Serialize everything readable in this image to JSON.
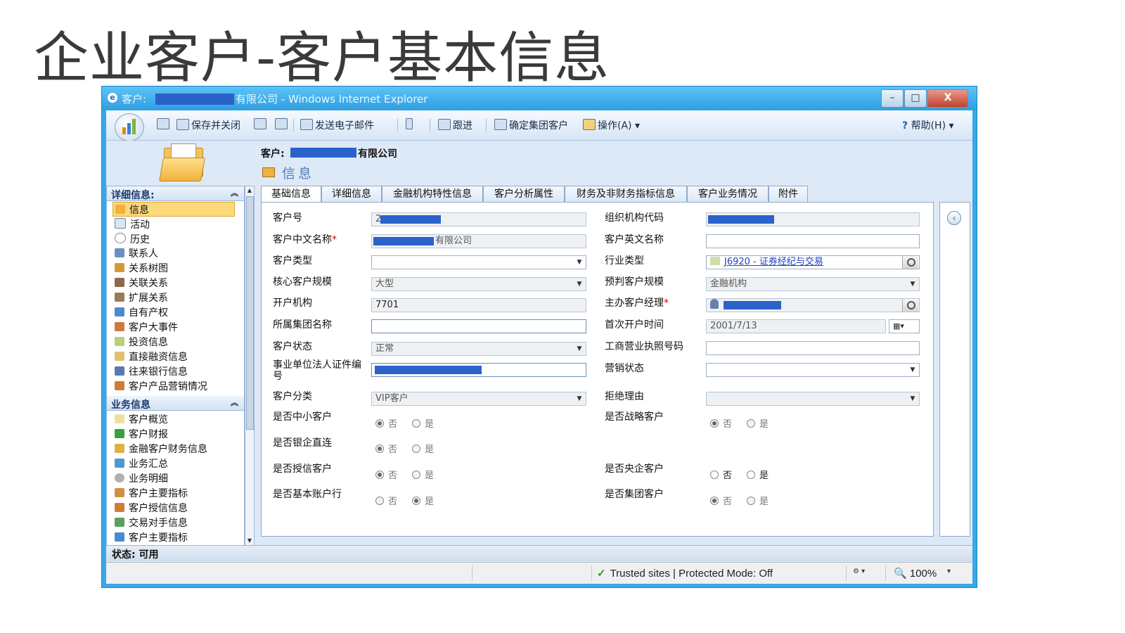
{
  "slide": {
    "title": "企业客户-客户基本信息"
  },
  "window": {
    "title_prefix": "客户:",
    "title_suffix": "有限公司 - Windows Internet Explorer",
    "min": "–",
    "max": "□",
    "close": "X"
  },
  "toolbar": {
    "save_close": "保存并关闭",
    "send_email": "发送电子邮件",
    "follow_up": "跟进",
    "confirm_group": "确定集团客户",
    "actions": "操作(A)",
    "help": "帮助(H)"
  },
  "header": {
    "customer_label": "客户:",
    "customer_suffix": "有限公司",
    "section_title": "信息"
  },
  "nav": {
    "details_title": "详细信息:",
    "details_items": [
      "信息",
      "活动",
      "历史",
      "联系人",
      "关系树图",
      "关联关系",
      "扩展关系",
      "自有产权",
      "客户大事件",
      "投资信息",
      "直接融资信息",
      "往来银行信息",
      "客户产品营销情况"
    ],
    "business_title": "业务信息",
    "business_items": [
      "客户概览",
      "客户财报",
      "金融客户财务信息",
      "业务汇总",
      "业务明细",
      "客户主要指标",
      "客户授信信息",
      "交易对手信息",
      "客户主要指标"
    ]
  },
  "tabs": [
    "基础信息",
    "详细信息",
    "金融机构特性信息",
    "客户分析属性",
    "财务及非财务指标信息",
    "客户业务情况",
    "附件"
  ],
  "form": {
    "customer_no": "客户号",
    "customer_no_value": "2",
    "org_code": "组织机构代码",
    "cn_name": "客户中文名称",
    "cn_name_value": "有限公司",
    "en_name": "客户英文名称",
    "customer_type": "客户类型",
    "industry_type": "行业类型",
    "industry_value": "J6920 - 证券经纪与交易",
    "core_scale": "核心客户规模",
    "core_scale_value": "大型",
    "pre_scale": "预判客户规模",
    "pre_scale_value": "金融机构",
    "branch": "开户机构",
    "branch_value": "7701",
    "manager": "主办客户经理",
    "group_name": "所属集团名称",
    "first_open": "首次开户时间",
    "first_open_value": "2001/7/13",
    "status": "客户状态",
    "status_value": "正常",
    "license_no": "工商营业执照号码",
    "legal_cert": "事业单位法人证件编号",
    "marketing_status": "营销状态",
    "category": "客户分类",
    "category_value": "VIP客户",
    "reject_reason": "拒绝理由",
    "is_sme": "是否中小客户",
    "is_strategic": "是否战略客户",
    "is_bank_direct": "是否银企直连",
    "is_credit": "是否授信客户",
    "is_central": "是否央企客户",
    "is_basic_account": "是否基本账户行",
    "is_group": "是否集团客户",
    "no": "否",
    "yes": "是"
  },
  "status": {
    "text": "状态: 可用"
  },
  "ie_status": {
    "trusted": "Trusted sites | Protected Mode: Off",
    "zoom": "100%"
  }
}
